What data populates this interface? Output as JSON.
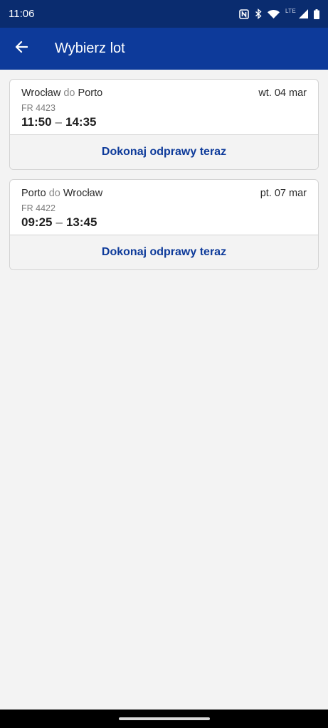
{
  "status_bar": {
    "time": "11:06",
    "network_label": "LTE",
    "icons": [
      "nfc-icon",
      "bluetooth-icon",
      "wifi-icon",
      "signal-icon",
      "battery-icon"
    ]
  },
  "app_bar": {
    "back_icon": "arrow-left-icon",
    "title": "Wybierz lot"
  },
  "flights": [
    {
      "from": "Wrocław",
      "connector": "do",
      "to": "Porto",
      "date": "wt. 04 mar",
      "flight_number": "FR 4423",
      "departure": "11:50",
      "arrival": "14:35",
      "action_label": "Dokonaj odprawy teraz"
    },
    {
      "from": "Porto",
      "connector": "do",
      "to": "Wrocław",
      "date": "pt. 07 mar",
      "flight_number": "FR 4422",
      "departure": "09:25",
      "arrival": "13:45",
      "action_label": "Dokonaj odprawy teraz"
    }
  ],
  "colors": {
    "status_bar": "#0a2c6f",
    "app_bar": "#0d3a9a",
    "accent": "#0d3a9a",
    "background": "#f3f3f3"
  }
}
